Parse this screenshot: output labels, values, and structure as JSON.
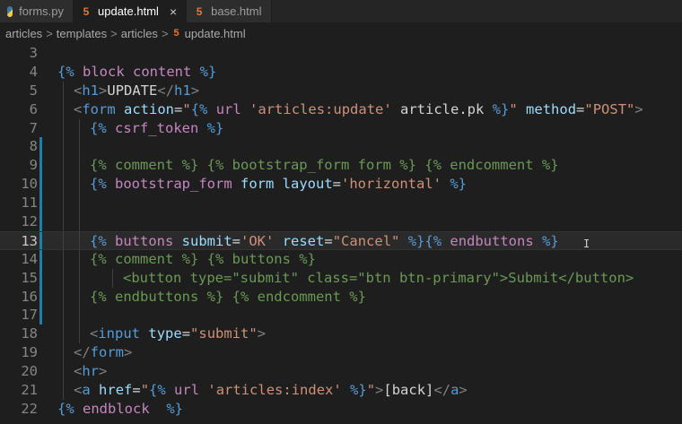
{
  "tabs": [
    {
      "label": "forms.py",
      "icon": "python-file-icon",
      "active": false
    },
    {
      "label": "update.html",
      "icon": "html-file-icon",
      "active": true,
      "close": "×"
    },
    {
      "label": "base.html",
      "icon": "html-file-icon",
      "active": false
    }
  ],
  "breadcrumb": {
    "parts": [
      "articles",
      "templates",
      "articles",
      "update.html"
    ],
    "separator": ">"
  },
  "editor": {
    "current_line": 13,
    "modified_lines": [
      8,
      9,
      10,
      11,
      12,
      13,
      14,
      15,
      16,
      17
    ],
    "lines": [
      {
        "n": "3",
        "tokens": []
      },
      {
        "n": "4",
        "tokens": [
          [
            "t-d",
            "{% "
          ],
          [
            "t-k",
            "block"
          ],
          [
            "t-w",
            " "
          ],
          [
            "t-k",
            "content"
          ],
          [
            "t-d",
            " %}"
          ]
        ]
      },
      {
        "n": "5",
        "tokens": [
          [
            "t-g",
            "<"
          ],
          [
            "t-tag",
            "h1"
          ],
          [
            "t-g",
            ">"
          ],
          [
            "t-w",
            "UPDATE"
          ],
          [
            "t-g",
            "</"
          ],
          [
            "t-tag",
            "h1"
          ],
          [
            "t-g",
            ">"
          ]
        ]
      },
      {
        "n": "6",
        "tokens": [
          [
            "t-g",
            "<"
          ],
          [
            "t-tag",
            "form"
          ],
          [
            "t-w",
            " "
          ],
          [
            "t-a",
            "action"
          ],
          [
            "t-w",
            "="
          ],
          [
            "t-s",
            "\""
          ],
          [
            "t-d",
            "{% "
          ],
          [
            "t-k",
            "url"
          ],
          [
            "t-w",
            " "
          ],
          [
            "t-s",
            "'articles:update'"
          ],
          [
            "t-w",
            " article.pk"
          ],
          [
            "t-d",
            " %}"
          ],
          [
            "t-s",
            "\""
          ],
          [
            "t-w",
            " "
          ],
          [
            "t-a",
            "method"
          ],
          [
            "t-w",
            "="
          ],
          [
            "t-s",
            "\"POST\""
          ],
          [
            "t-g",
            ">"
          ]
        ]
      },
      {
        "n": "7",
        "tokens": [
          [
            "t-d",
            "{% "
          ],
          [
            "t-k",
            "csrf_token"
          ],
          [
            "t-d",
            " %}"
          ]
        ]
      },
      {
        "n": "8",
        "tokens": []
      },
      {
        "n": "9",
        "tokens": [
          [
            "t-c",
            "{% comment %} {% bootstrap_form form %} {% endcomment %}"
          ]
        ]
      },
      {
        "n": "10",
        "tokens": [
          [
            "t-d",
            "{% "
          ],
          [
            "t-k",
            "bootstrap_form"
          ],
          [
            "t-w",
            " "
          ],
          [
            "t-a",
            "form"
          ],
          [
            "t-w",
            " "
          ],
          [
            "t-a",
            "layout"
          ],
          [
            "t-w",
            "="
          ],
          [
            "t-s",
            "'horizontal'"
          ],
          [
            "t-d",
            " %}"
          ]
        ]
      },
      {
        "n": "11",
        "tokens": []
      },
      {
        "n": "12",
        "tokens": []
      },
      {
        "n": "13",
        "tokens": [
          [
            "t-d",
            "{% "
          ],
          [
            "t-k",
            "buttons"
          ],
          [
            "t-w",
            " "
          ],
          [
            "t-a",
            "submit"
          ],
          [
            "t-w",
            "="
          ],
          [
            "t-s",
            "'OK'"
          ],
          [
            "t-w",
            " "
          ],
          [
            "t-a",
            "reset"
          ],
          [
            "t-w",
            "="
          ],
          [
            "t-s",
            "\"Cancel\""
          ],
          [
            "t-d",
            " %}"
          ],
          [
            "t-d",
            "{% "
          ],
          [
            "t-k",
            "endbuttons"
          ],
          [
            "t-d",
            " %}"
          ]
        ]
      },
      {
        "n": "14",
        "tokens": [
          [
            "t-c",
            "{% comment %} {% buttons %}"
          ]
        ]
      },
      {
        "n": "15",
        "tokens": [
          [
            "t-c",
            "<button type=\"submit\" class=\"btn btn-primary\">Submit</button>"
          ]
        ]
      },
      {
        "n": "16",
        "tokens": [
          [
            "t-c",
            "{% endbuttons %} {% endcomment %}"
          ]
        ]
      },
      {
        "n": "17",
        "tokens": []
      },
      {
        "n": "18",
        "tokens": [
          [
            "t-g",
            "<"
          ],
          [
            "t-tag",
            "input"
          ],
          [
            "t-w",
            " "
          ],
          [
            "t-a",
            "type"
          ],
          [
            "t-w",
            "="
          ],
          [
            "t-s",
            "\"submit\""
          ],
          [
            "t-g",
            ">"
          ]
        ]
      },
      {
        "n": "19",
        "tokens": [
          [
            "t-g",
            "</"
          ],
          [
            "t-tag",
            "form"
          ],
          [
            "t-g",
            ">"
          ]
        ]
      },
      {
        "n": "20",
        "tokens": [
          [
            "t-g",
            "<"
          ],
          [
            "t-tag",
            "hr"
          ],
          [
            "t-g",
            ">"
          ]
        ]
      },
      {
        "n": "21",
        "tokens": [
          [
            "t-g",
            "<"
          ],
          [
            "t-tag",
            "a"
          ],
          [
            "t-w",
            " "
          ],
          [
            "t-a",
            "href"
          ],
          [
            "t-w",
            "="
          ],
          [
            "t-s",
            "\""
          ],
          [
            "t-d",
            "{% "
          ],
          [
            "t-k",
            "url"
          ],
          [
            "t-w",
            " "
          ],
          [
            "t-s",
            "'articles:index'"
          ],
          [
            "t-d",
            " %}"
          ],
          [
            "t-s",
            "\""
          ],
          [
            "t-g",
            ">"
          ],
          [
            "t-w",
            "[back]"
          ],
          [
            "t-g",
            "</"
          ],
          [
            "t-tag",
            "a"
          ],
          [
            "t-g",
            ">"
          ]
        ]
      },
      {
        "n": "22",
        "tokens": [
          [
            "t-d",
            "{% "
          ],
          [
            "t-k",
            "endblock"
          ],
          [
            "t-w",
            "  "
          ],
          [
            "t-d",
            "%}"
          ]
        ]
      }
    ]
  }
}
